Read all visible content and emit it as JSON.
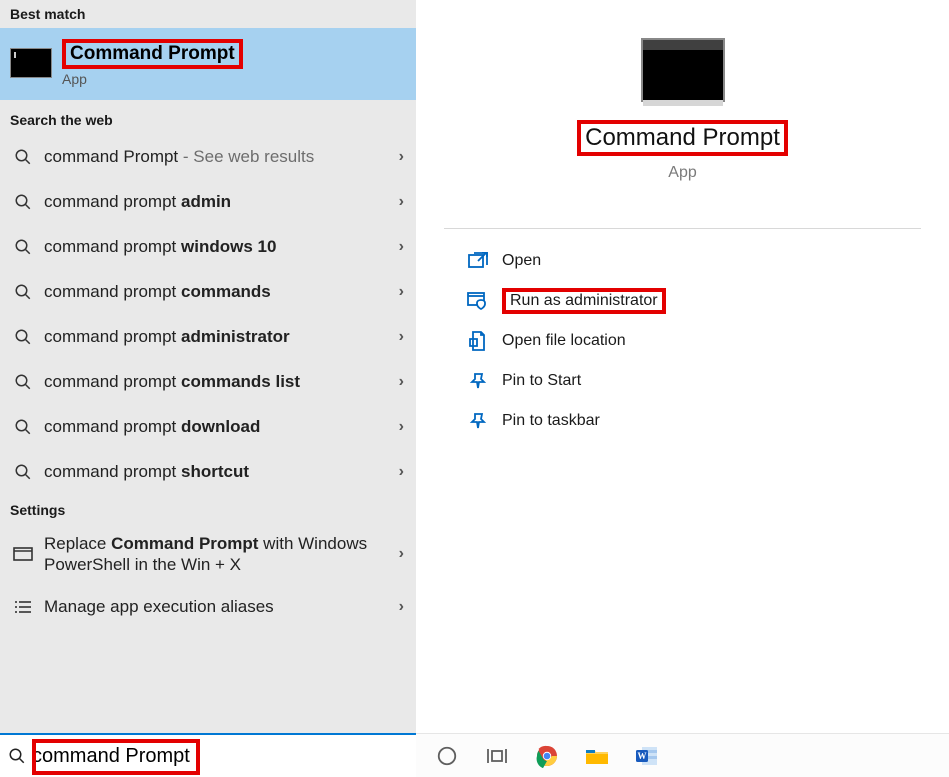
{
  "left": {
    "best_match_header": "Best match",
    "best_match": {
      "title": "Command Prompt",
      "subtitle": "App"
    },
    "web_header": "Search the web",
    "web": [
      {
        "pre": "command Prompt",
        "bold": "",
        "tail": " - See web results"
      },
      {
        "pre": "command prompt ",
        "bold": "admin",
        "tail": ""
      },
      {
        "pre": "command prompt ",
        "bold": "windows 10",
        "tail": ""
      },
      {
        "pre": "command prompt ",
        "bold": "commands",
        "tail": ""
      },
      {
        "pre": "command prompt ",
        "bold": "administrator",
        "tail": ""
      },
      {
        "pre": "command prompt ",
        "bold": "commands list",
        "tail": ""
      },
      {
        "pre": "command prompt ",
        "bold": "download",
        "tail": ""
      },
      {
        "pre": "command prompt ",
        "bold": "shortcut",
        "tail": ""
      }
    ],
    "settings_header": "Settings",
    "settings": [
      {
        "text_a": "Replace ",
        "text_b": "Command Prompt",
        "text_c": " with Windows PowerShell in the Win + X"
      },
      {
        "text": "Manage app execution aliases"
      }
    ]
  },
  "right": {
    "title": "Command Prompt",
    "subtitle": "App",
    "actions": [
      {
        "icon": "open",
        "label": "Open"
      },
      {
        "icon": "admin",
        "label": "Run as administrator",
        "highlight": true
      },
      {
        "icon": "folder",
        "label": "Open file location"
      },
      {
        "icon": "pin-start",
        "label": "Pin to Start"
      },
      {
        "icon": "pin-taskbar",
        "label": "Pin to taskbar"
      }
    ]
  },
  "search": {
    "query": "command Prompt"
  }
}
